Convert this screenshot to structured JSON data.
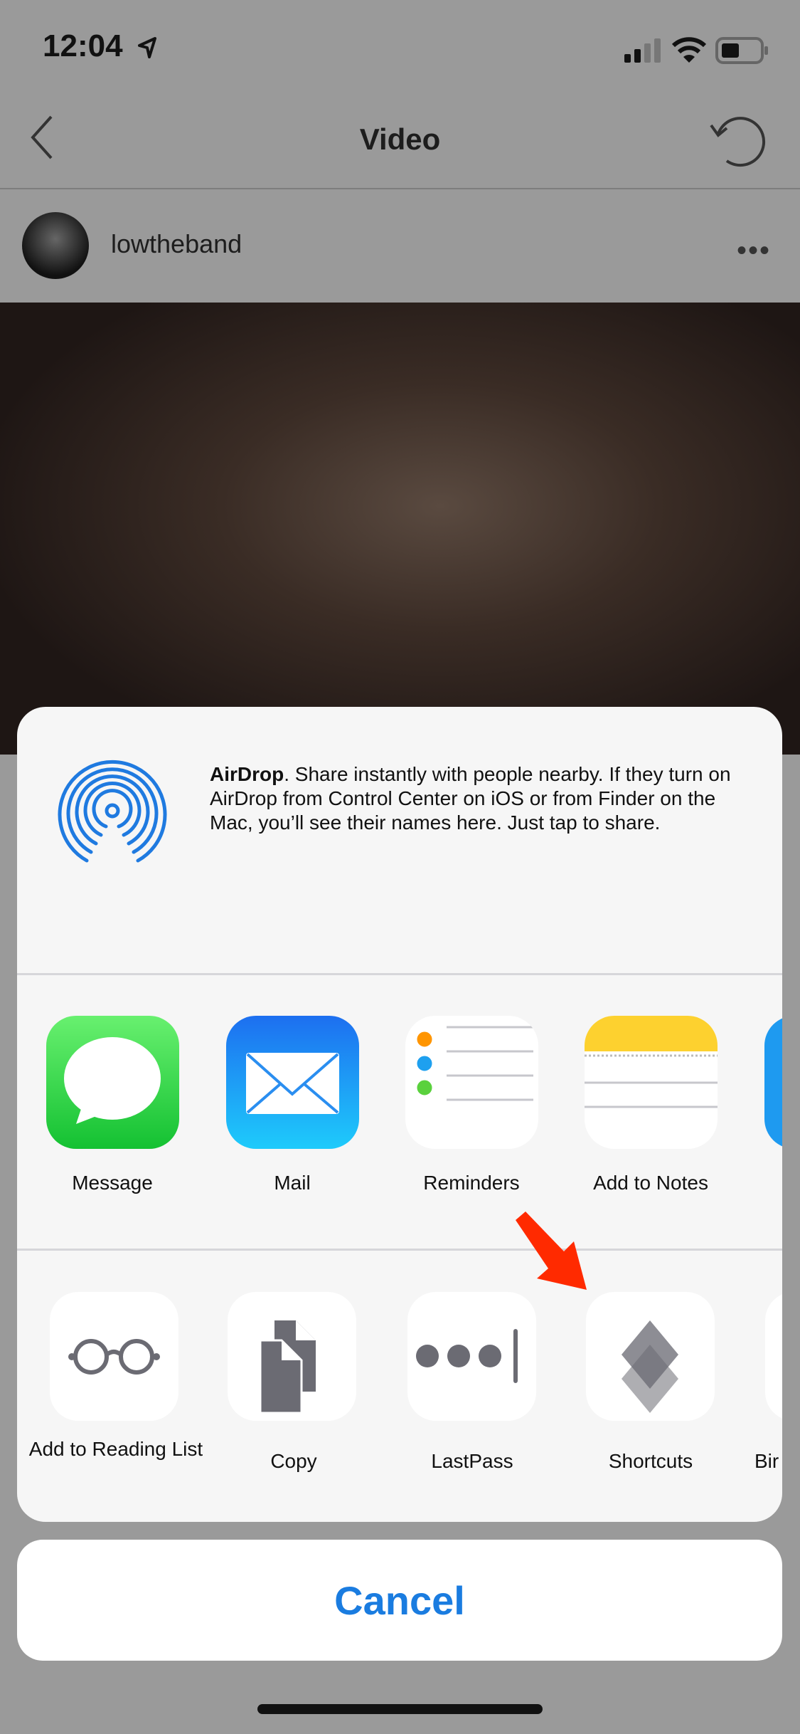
{
  "status_bar": {
    "time": "12:04",
    "icons": [
      "location-arrow-icon",
      "signal-icon",
      "wifi-icon",
      "battery-icon"
    ]
  },
  "nav": {
    "title": "Video",
    "back_icon": "chevron-left-icon",
    "refresh_icon": "refresh-icon"
  },
  "post": {
    "username": "lowtheband",
    "more": "•••"
  },
  "share_sheet": {
    "airdrop": {
      "title": "AirDrop",
      "description": ". Share instantly with people nearby. If they turn on AirDrop from Control Center on iOS or from Finder on the Mac, you’ll see their names here. Just tap to share."
    },
    "apps": [
      {
        "label": "Message"
      },
      {
        "label": "Mail"
      },
      {
        "label": "Reminders"
      },
      {
        "label": "Add to Notes"
      }
    ],
    "actions": [
      {
        "label": "Add to Reading List"
      },
      {
        "label": "Copy"
      },
      {
        "label": "LastPass"
      },
      {
        "label": "Shortcuts"
      },
      {
        "label": "Bir"
      }
    ],
    "cancel_label": "Cancel"
  },
  "colors": {
    "accent": "#1a7ce0",
    "annotation_arrow": "#ff2a00"
  }
}
